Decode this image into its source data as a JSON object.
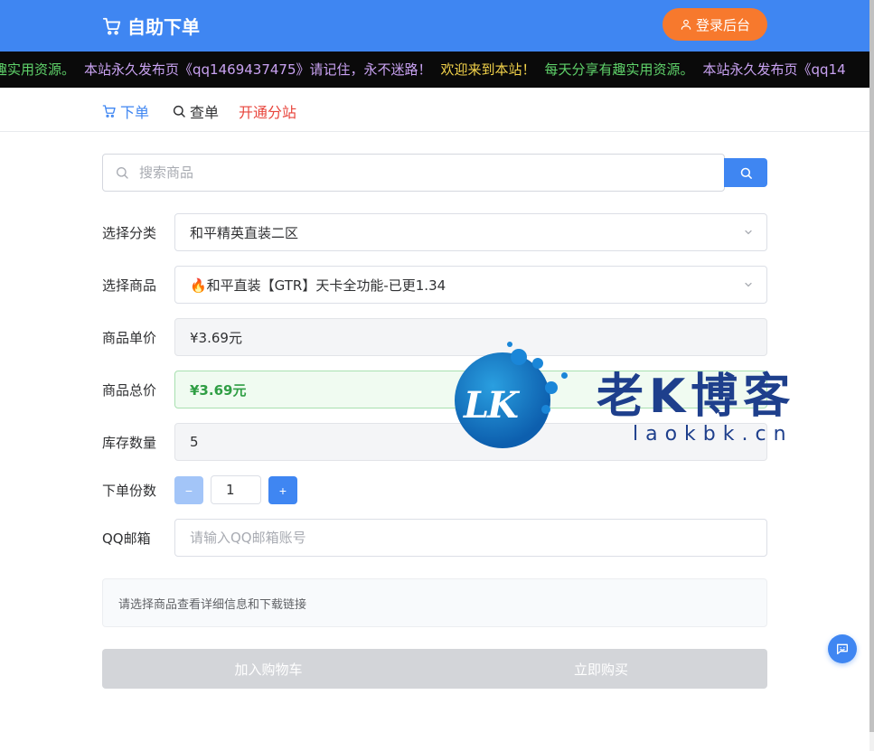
{
  "header": {
    "brand": "自助下单",
    "login_label": "登录后台",
    "brand_color": "#3f86f2",
    "login_color": "#f7792d"
  },
  "marquee": {
    "segments": [
      {
        "text": "有趣实用资源。",
        "color": "green"
      },
      {
        "text": "本站永久发布页《qq1469437475》请记住，永不迷路！",
        "color": "purple"
      },
      {
        "text": "欢迎来到本站！",
        "color": "yellow"
      },
      {
        "text": "每天分享有趣实用资源。",
        "color": "green"
      },
      {
        "text": "本站永久发布页《qq14",
        "color": "purple"
      }
    ]
  },
  "nav": {
    "order": "下单",
    "query": "查单",
    "branch": "开通分站"
  },
  "search": {
    "placeholder": "搜索商品"
  },
  "form": {
    "category_label": "选择分类",
    "category_value": "和平精英直装二区",
    "product_label": "选择商品",
    "product_value": "🔥和平直装【GTR】天卡全功能-已更1.34",
    "unit_price_label": "商品单价",
    "unit_price_value": "¥3.69元",
    "total_price_label": "商品总价",
    "total_price_value": "¥3.69元",
    "stock_label": "库存数量",
    "stock_value": "5",
    "quantity_label": "下单份数",
    "quantity_value": "1",
    "minus_label": "−",
    "plus_label": "+",
    "email_label": "QQ邮箱",
    "email_placeholder": "请输入QQ邮箱账号"
  },
  "info": {
    "text": "请选择商品查看详细信息和下载链接"
  },
  "actions": {
    "add_to_cart": "加入购物车",
    "buy_now": "立即购买"
  },
  "watermark": {
    "logo_text": "LK",
    "title": "老K博客",
    "url": "laokbk.cn"
  },
  "icons": {
    "cart": "cart-icon",
    "user": "user-icon",
    "search": "search-icon",
    "chevron": "chevron-down-icon",
    "chat": "chat-icon"
  }
}
